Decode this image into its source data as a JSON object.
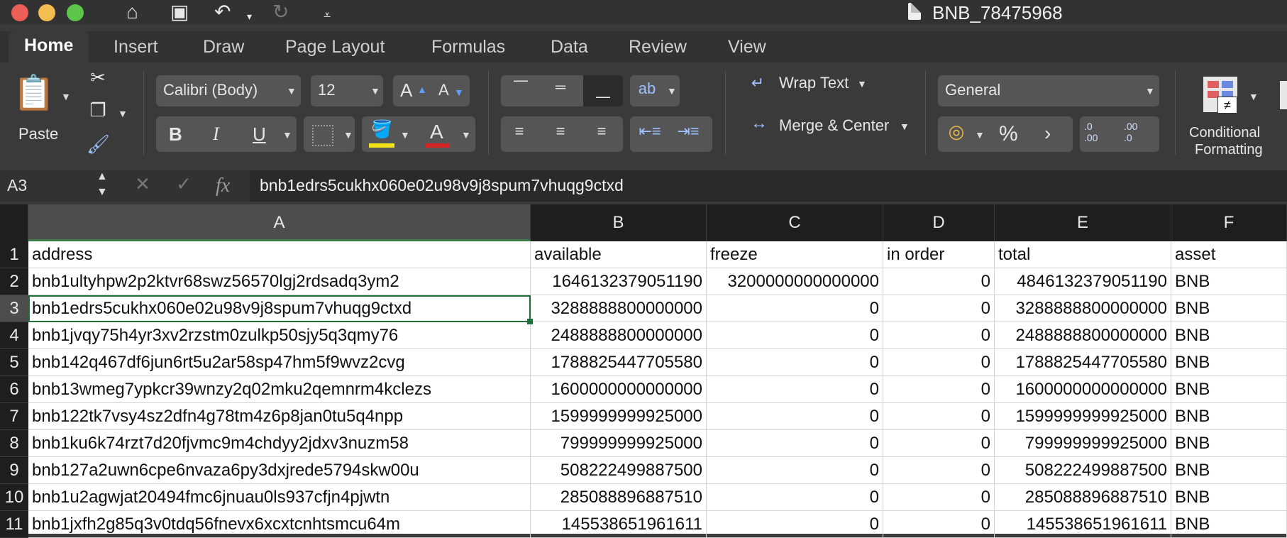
{
  "window": {
    "title": "BNB_78475968"
  },
  "tabs": [
    "Home",
    "Insert",
    "Draw",
    "Page Layout",
    "Formulas",
    "Data",
    "Review",
    "View"
  ],
  "ribbon": {
    "paste_label": "Paste",
    "font_name": "Calibri (Body)",
    "font_size": "12",
    "bold": "B",
    "italic": "I",
    "underline": "U",
    "grow_font": "A",
    "shrink_font": "A",
    "font_color_glyph": "A",
    "wrap_text": "Wrap Text",
    "merge_center": "Merge & Center",
    "number_format": "General",
    "percent": "%",
    "comma": "›",
    "increase_decimal": ".0\n.00",
    "decrease_decimal": ".00\n.0",
    "conditional_formatting_1": "Conditional",
    "conditional_formatting_2": "Formatting",
    "fill_color": "#f1e21a",
    "font_color": "#d62323"
  },
  "formula_bar": {
    "name_box": "A3",
    "fx": "fx",
    "formula": "bnb1edrs5cukhx060e02u98v9j8spum7vhuqg9ctxd"
  },
  "sheet": {
    "columns": [
      "A",
      "B",
      "C",
      "D",
      "E",
      "F"
    ],
    "row_numbers": [
      "1",
      "2",
      "3",
      "4",
      "5",
      "6",
      "7",
      "8",
      "9",
      "10",
      "11"
    ],
    "rows": [
      [
        "address",
        "available",
        "freeze",
        "in order",
        "total",
        "asset"
      ],
      [
        "bnb1ultyhpw2p2ktvr68swz56570lgj2rdsadq3ym2",
        "1646132379051190",
        "3200000000000000",
        "0",
        "4846132379051190",
        "BNB"
      ],
      [
        "bnb1edrs5cukhx060e02u98v9j8spum7vhuqg9ctxd",
        "3288888800000000",
        "0",
        "0",
        "3288888800000000",
        "BNB"
      ],
      [
        "bnb1jvqy75h4yr3xv2rzstm0zulkp50sjy5q3qmy76",
        "2488888800000000",
        "0",
        "0",
        "2488888800000000",
        "BNB"
      ],
      [
        "bnb142q467df6jun6rt5u2ar58sp47hm5f9wvz2cvg",
        "1788825447705580",
        "0",
        "0",
        "1788825447705580",
        "BNB"
      ],
      [
        "bnb13wmeg7ypkcr39wnzy2q02mku2qemnrm4kclezs",
        "1600000000000000",
        "0",
        "0",
        "1600000000000000",
        "BNB"
      ],
      [
        "bnb122tk7vsy4sz2dfn4g78tm4z6p8jan0tu5q4npp",
        "1599999999925000",
        "0",
        "0",
        "1599999999925000",
        "BNB"
      ],
      [
        "bnb1ku6k74rzt7d20fjvmc9m4chdyy2jdxv3nuzm58",
        "799999999925000",
        "0",
        "0",
        "799999999925000",
        "BNB"
      ],
      [
        "bnb127a2uwn6cpe6nvaza6py3dxjrede5794skw00u",
        "508222499887500",
        "0",
        "0",
        "508222499887500",
        "BNB"
      ],
      [
        "bnb1u2agwjat20494fmc6jnuau0ls937cfjn4pjwtn",
        "285088896887510",
        "0",
        "0",
        "285088896887510",
        "BNB"
      ],
      [
        "bnb1jxfh2g85q3v0tdq56fnevx6xcxtcnhtsmcu64m",
        "145538651961611",
        "0",
        "0",
        "145538651961611",
        "BNB"
      ]
    ],
    "active_cell": "A3"
  }
}
